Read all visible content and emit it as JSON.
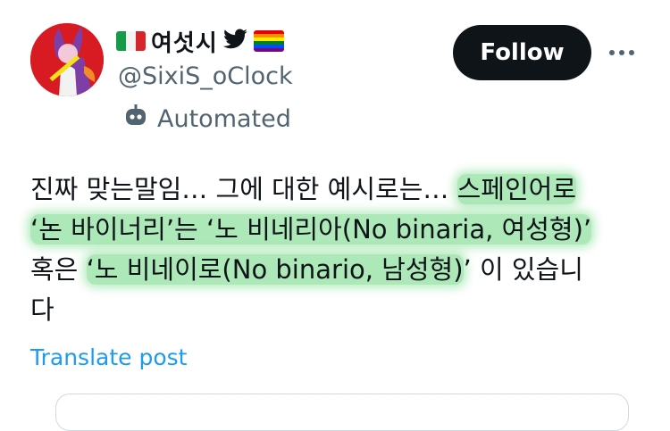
{
  "author": {
    "display_name": "여섯시",
    "handle": "@SixiS_oClock",
    "badge_label": "Automated",
    "flags": [
      "italy-flag-icon",
      "bird-icon",
      "rainbow-flag-icon"
    ]
  },
  "actions": {
    "follow_label": "Follow",
    "more_icon": "more-icon"
  },
  "tweet": {
    "line1_plain": "진짜 맞는말임… 그에 대한 예시로는… ",
    "line1_hl": "스페인어로",
    "line2_hl": "‘논 바이너리’는 ‘노 비네리아(No binaria, 여성형)’",
    "line3_plain_a": "혹은 ",
    "line3_hl": "‘노 비네이로(No binario, 남성형)",
    "line3_plain_b": "’ 이 있습니",
    "line4_plain": "다"
  },
  "translate_label": "Translate post",
  "colors": {
    "text": "#0f1419",
    "secondary": "#536471",
    "link": "#1d9bf0",
    "highlight": "#69d67d",
    "follow_bg": "#0f1419"
  }
}
